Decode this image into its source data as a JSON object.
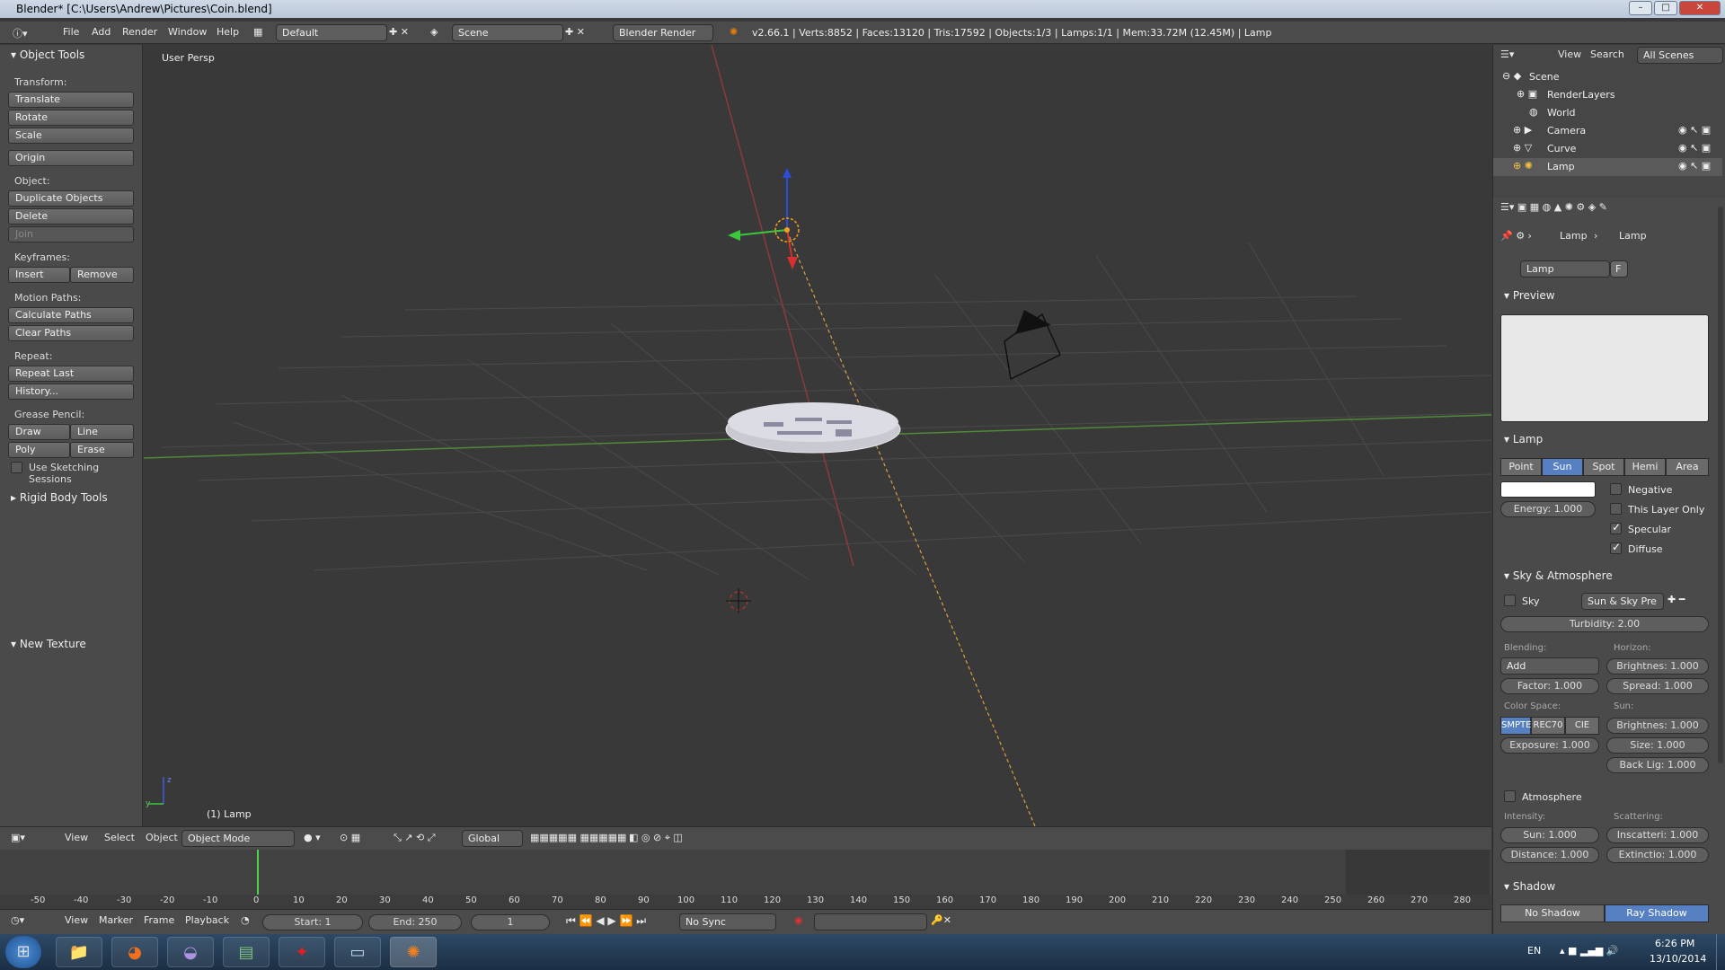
{
  "window": {
    "title": "Blender* [C:\\Users\\Andrew\\Pictures\\Coin.blend]",
    "minimize": "–",
    "maximize": "□",
    "close": "✕"
  },
  "infobar": {
    "menus": [
      "File",
      "Add",
      "Render",
      "Window",
      "Help"
    ],
    "layout": "Default",
    "scene": "Scene",
    "engine": "Blender Render",
    "stats": "v2.66.1 | Verts:8852 | Faces:13120 | Tris:17592 | Objects:1/3 | Lamps:1/1 | Mem:33.72M (12.45M) | Lamp"
  },
  "tools": {
    "title": "Object Tools",
    "transform_label": "Transform:",
    "translate": "Translate",
    "rotate": "Rotate",
    "scale": "Scale",
    "origin": "Origin",
    "object_label": "Object:",
    "duplicate": "Duplicate Objects",
    "delete": "Delete",
    "join": "Join",
    "keyframes_label": "Keyframes:",
    "insert": "Insert",
    "remove": "Remove",
    "motion_label": "Motion Paths:",
    "calc_paths": "Calculate Paths",
    "clear_paths": "Clear Paths",
    "repeat_label": "Repeat:",
    "repeat_last": "Repeat Last",
    "history": "History...",
    "grease_label": "Grease Pencil:",
    "draw": "Draw",
    "line": "Line",
    "poly": "Poly",
    "erase": "Erase",
    "sketching": "Use Sketching Sessions",
    "rigid_body": "Rigid Body Tools",
    "new_texture": "New Texture"
  },
  "viewport": {
    "label": "User Persp",
    "selected": "(1) Lamp",
    "axis_z": "z",
    "axis_y": "y"
  },
  "viewheader": {
    "view": "View",
    "select": "Select",
    "object": "Object",
    "mode": "Object Mode",
    "orientation": "Global"
  },
  "timeline": {
    "ticks": [
      "-50",
      "-40",
      "-30",
      "-20",
      "-10",
      "0",
      "10",
      "20",
      "30",
      "40",
      "50",
      "60",
      "70",
      "80",
      "90",
      "100",
      "110",
      "120",
      "130",
      "140",
      "150",
      "160",
      "170",
      "180",
      "190",
      "200",
      "210",
      "220",
      "230",
      "240",
      "250",
      "260",
      "270",
      "280"
    ],
    "view": "View",
    "marker": "Marker",
    "frame": "Frame",
    "playback": "Playback",
    "start": "Start: 1",
    "end": "End: 250",
    "current": "1",
    "sync": "No Sync"
  },
  "outliner": {
    "view": "View",
    "search": "Search",
    "filter": "All Scenes",
    "items": [
      "Scene",
      "RenderLayers",
      "World",
      "Camera",
      "Curve",
      "Lamp"
    ]
  },
  "properties": {
    "breadcrumb_obj": "Lamp",
    "breadcrumb_data": "Lamp",
    "datablock": "Lamp",
    "fake": "F",
    "preview": "Preview",
    "lamp_section": "Lamp",
    "types": [
      "Point",
      "Sun",
      "Spot",
      "Hemi",
      "Area"
    ],
    "selected_type": "Sun",
    "energy": "Energy: 1.000",
    "negative": "Negative",
    "layer_only": "This Layer Only",
    "specular": "Specular",
    "diffuse": "Diffuse",
    "sky_section": "Sky & Atmosphere",
    "sky": "Sky",
    "sky_preset": "Sun & Sky Pre",
    "turbidity": "Turbidity: 2.00",
    "blending": "Blending:",
    "horizon": "Horizon:",
    "add": "Add",
    "h_bright": "Brightnes: 1.000",
    "factor": "Factor: 1.000",
    "spread": "Spread: 1.000",
    "color_space": "Color Space:",
    "sun_label": "Sun:",
    "cs_smpte": "SMPTE",
    "cs_rec": "REC70",
    "cs_cie": "CIE",
    "s_bright": "Brightnes: 1.000",
    "exposure": "Exposure: 1.000",
    "size": "Size: 1.000",
    "backlight": "Back Lig: 1.000",
    "atmosphere": "Atmosphere",
    "intensity": "Intensity:",
    "scattering": "Scattering:",
    "a_sun": "Sun: 1.000",
    "inscatter": "Inscatteri: 1.000",
    "distance": "Distance: 1.000",
    "extinction": "Extinctio: 1.000",
    "shadow_section": "Shadow",
    "no_shadow": "No Shadow",
    "ray_shadow": "Ray Shadow"
  },
  "taskbar": {
    "lang": "EN",
    "time": "6:26 PM",
    "date": "13/10/2014"
  }
}
